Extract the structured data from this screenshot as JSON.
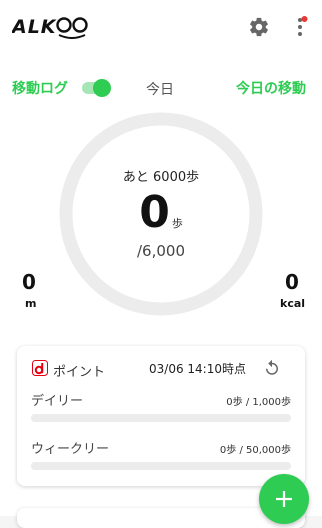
{
  "colors": {
    "accent": "#2ecc52",
    "notification": "#e53935",
    "d_logo": "#e60012"
  },
  "header": {
    "logo_text": "ALKOO",
    "settings_icon": "gear-icon",
    "menu_icon": "more-vertical-icon"
  },
  "tabs": {
    "log_label": "移動ログ",
    "log_toggle_on": true,
    "today_label": "今日",
    "move_label": "今日の移動"
  },
  "summary": {
    "remaining_text": "あと 6000歩",
    "steps": "0",
    "steps_unit": "歩",
    "goal_text": "/6,000",
    "progress": 0,
    "distance": {
      "value": "0",
      "unit": "m"
    },
    "calories": {
      "value": "0",
      "unit": "kcal"
    }
  },
  "points_card": {
    "brand_icon": "d-point-icon",
    "title": "ポイント",
    "timestamp": "03/06 14:10時点",
    "refresh_icon": "refresh-icon",
    "daily": {
      "label": "デイリー",
      "value": "0歩 / 1,000歩",
      "progress": 0
    },
    "weekly": {
      "label": "ウィークリー",
      "value": "0歩 / 50,000歩",
      "progress": 0
    }
  },
  "fab": {
    "icon": "plus-icon"
  }
}
